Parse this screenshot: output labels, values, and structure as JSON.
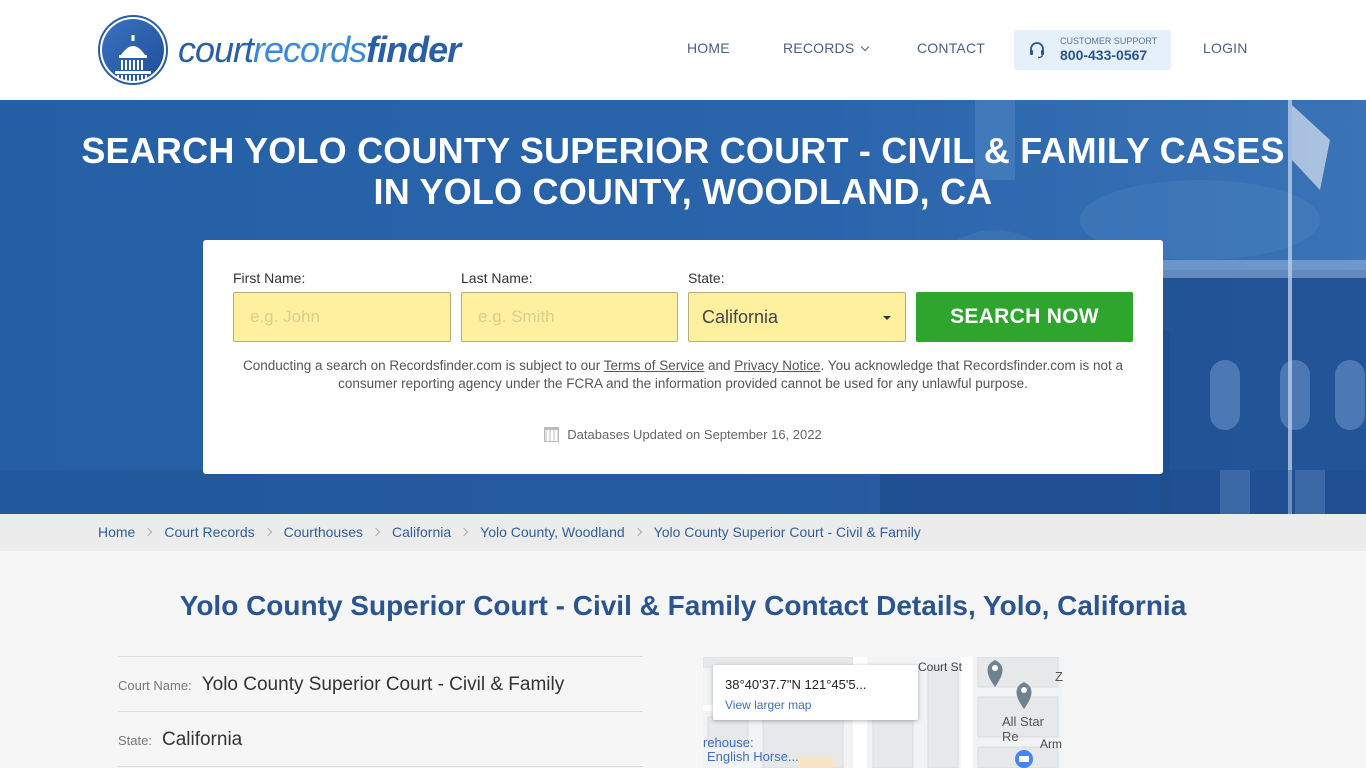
{
  "brand": {
    "part1": "court",
    "part2": "records",
    "part3": "finder"
  },
  "nav": {
    "home": "HOME",
    "records": "RECORDS",
    "contact": "CONTACT",
    "support_label": "CUSTOMER SUPPORT",
    "support_phone": "800-433-0567",
    "login": "LOGIN"
  },
  "hero": {
    "title_line1": "SEARCH YOLO COUNTY SUPERIOR COURT - CIVIL & FAMILY CASES",
    "title_line2": "IN YOLO COUNTY, WOODLAND, CA"
  },
  "search": {
    "first_name_label": "First Name:",
    "first_name_placeholder": "e.g. John",
    "first_name_value": "",
    "last_name_label": "Last Name:",
    "last_name_placeholder": "e.g. Smith",
    "last_name_value": "",
    "state_label": "State:",
    "state_value": "California",
    "button_label": "SEARCH NOW",
    "disclaimer_part1": "Conducting a search on Recordsfinder.com is subject to our ",
    "terms_link": "Terms of Service",
    "disclaimer_and": " and ",
    "privacy_link": "Privacy Notice",
    "disclaimer_part2": ". You acknowledge that Recordsfinder.com is not a consumer reporting agency under the FCRA and the information provided cannot be used for any unlawful purpose.",
    "updated": "Databases Updated on September 16, 2022"
  },
  "breadcrumb": [
    {
      "label": "Home"
    },
    {
      "label": "Court Records"
    },
    {
      "label": "Courthouses"
    },
    {
      "label": "California"
    },
    {
      "label": "Yolo County, Woodland"
    },
    {
      "label": "Yolo County Superior Court - Civil & Family"
    }
  ],
  "main": {
    "title": "Yolo County Superior Court - Civil & Family Contact Details, Yolo, California",
    "details": [
      {
        "label": "Court Name:",
        "value": "Yolo County Superior Court - Civil & Family"
      },
      {
        "label": "State:",
        "value": "California"
      }
    ]
  },
  "map": {
    "coords": "38°40'37.7\"N 121°45'5...",
    "view_larger": "View larger map",
    "street_label": "Court St",
    "place1": "All Star Re",
    "place2": "Arm",
    "place3": "Z",
    "place4_line1": "rehouse:",
    "place4_line2": "English Horse..."
  },
  "colors": {
    "brand_blue": "#2a5ea6",
    "hero_blue": "#2560a6",
    "search_green": "#2ea52c",
    "field_yellow": "#fff0a0"
  }
}
